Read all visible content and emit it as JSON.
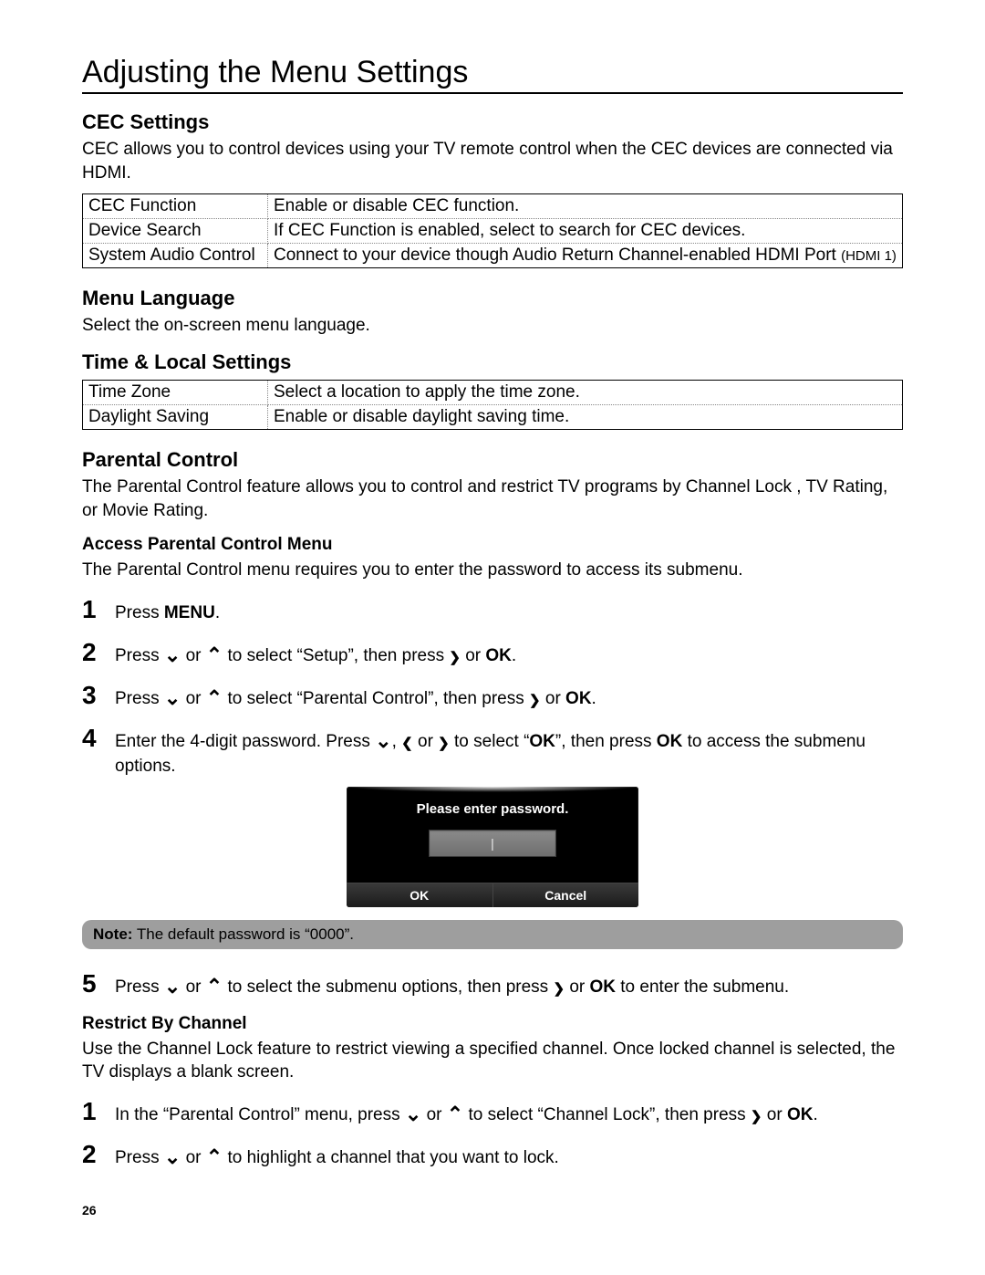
{
  "page_title": "Adjusting the Menu Settings",
  "page_number": "26",
  "cec": {
    "heading": "CEC Settings",
    "desc": "CEC allows you to control devices using your TV remote control when the CEC devices are connected via HDMI.",
    "rows": [
      {
        "label": "CEC Function",
        "desc": "Enable or disable CEC function."
      },
      {
        "label": "Device Search",
        "desc": "If CEC Function is enabled, select to search for CEC devices."
      },
      {
        "label": "System Audio Control",
        "desc": "Connect to your device though Audio Return Channel-enabled HDMI Port ",
        "desc_small": "(HDMI 1)"
      }
    ]
  },
  "menu_lang": {
    "heading": "Menu Language",
    "desc": "Select the on-screen menu language."
  },
  "time": {
    "heading": "Time & Local Settings",
    "rows": [
      {
        "label": "Time Zone",
        "desc": "Select a location to apply the time zone."
      },
      {
        "label": "Daylight Saving",
        "desc": "Enable or disable daylight saving time."
      }
    ]
  },
  "parental": {
    "heading": "Parental Control",
    "desc": "The Parental Control feature allows you to control and restrict TV programs by Channel Lock , TV Rating, or Movie Rating.",
    "access_heading": "Access Parental Control Menu",
    "access_desc": "The Parental Control menu requires you to enter the password to access its submenu.",
    "steps": {
      "s1_a": "Press ",
      "s1_b": "MENU",
      "s1_c": ".",
      "s2_a": "Press ",
      "s2_b": " or ",
      "s2_c": "  to select “Setup”, then press ",
      "s2_d": " or ",
      "s2_e": "OK",
      "s2_f": ".",
      "s3_a": "Press ",
      "s3_b": " or ",
      "s3_c": "  to select “Parental Control”, then press ",
      "s3_d": " or ",
      "s3_e": "OK",
      "s3_f": ".",
      "s4_a": "Enter the 4-digit password. Press  ",
      "s4_b": ", ",
      "s4_c": " or  ",
      "s4_d": "  to select “",
      "s4_e": "OK",
      "s4_f": "”, then press ",
      "s4_g": "OK",
      "s4_h": " to access the submenu options.",
      "s5_a": "Press ",
      "s5_b": " or ",
      "s5_c": "  to select the submenu options, then press  ",
      "s5_d": " or ",
      "s5_e": "OK",
      "s5_f": " to enter the submenu."
    },
    "osd": {
      "prompt": "Please enter password.",
      "ok": "OK",
      "cancel": "Cancel"
    },
    "note_label": "Note:",
    "note_text": " The default password is “0000”."
  },
  "restrict": {
    "heading": "Restrict By Channel",
    "desc": "Use the Channel Lock feature to restrict viewing a specified channel. Once locked channel is selected, the TV displays a blank screen.",
    "s1_a": "In the “Parental Control” menu, press ",
    "s1_b": " or ",
    "s1_c": "  to select “Channel Lock”, then press ",
    "s1_d": " or ",
    "s1_e": "OK",
    "s1_f": ".",
    "s2_a": "Press ",
    "s2_b": " or ",
    "s2_c": " to highlight a channel that you want to lock."
  }
}
